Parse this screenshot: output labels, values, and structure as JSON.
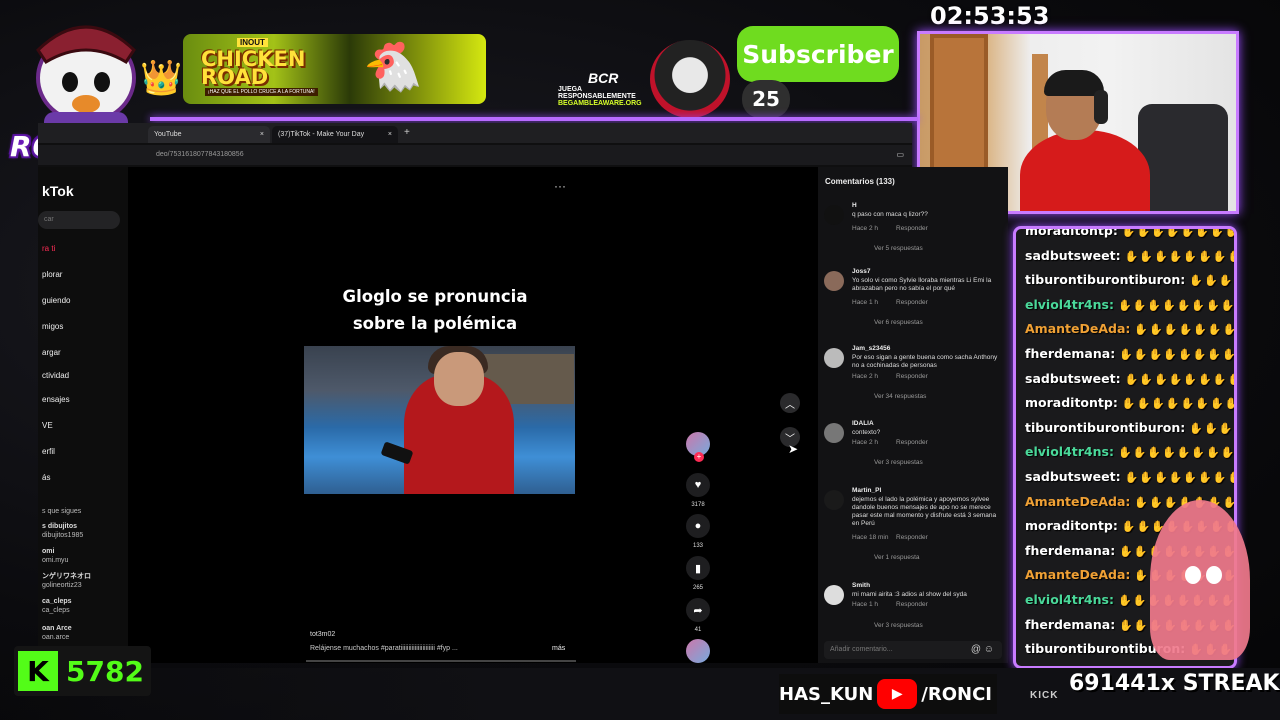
{
  "overlay": {
    "logo_text": "RONCHAS",
    "banner": {
      "brand": "INOUT",
      "title": "CHICKEN ROAD",
      "subtitle": "¡HAZ QUE EL POLLO CRUCE A LA FORTUNA!"
    },
    "responsible": {
      "brand": "BCR",
      "line1": "JUEGA RESPONSABLEMENTE",
      "line2": "BEGAMBLEAWARE.ORG"
    },
    "subscriber_label": "Subscriber",
    "subscriber_count": "25",
    "timer": "02:53:53",
    "kick_count": "5782",
    "social_text1": "HAS_KUN",
    "social_text2": "/RONCI",
    "sponsors": "KICK",
    "streak": "691441x STREAK",
    "accent": "#c87bff",
    "kick_green": "#53fc18"
  },
  "browser": {
    "tabs": [
      {
        "label": "YouTube",
        "close": "×"
      },
      {
        "label": "(37)TikTok - Make Your Day",
        "close": "×"
      }
    ],
    "new_tab": "+",
    "url": "deo/7531618077843180856"
  },
  "tiktok": {
    "logo": "kTok",
    "search_placeholder": "car",
    "nav": [
      "ra ti",
      "plorar",
      "guiendo",
      "migos",
      "argar",
      "ctividad",
      "ensajes",
      "VE",
      "erfil",
      "ás"
    ],
    "following_title": "s que sigues",
    "following": [
      {
        "name": "s dibujitos",
        "handle": "dibujitos1985"
      },
      {
        "name": "omi",
        "handle": "omi.myu"
      },
      {
        "name": "ンゲリワネオロ",
        "handle": "golineortiz23"
      },
      {
        "name": "ca_cleps",
        "handle": "ca_cleps"
      },
      {
        "name": "oan Arce",
        "handle": "oan.arce"
      }
    ],
    "more_icon": "···",
    "video_title_line1": "Gloglo se pronuncia",
    "video_title_line2": "sobre la polémica",
    "actions": {
      "likes": "3178",
      "comments": "133",
      "saves": "265",
      "shares": "41"
    },
    "author": "tot3m02",
    "caption": "Relájense muchachos  #paratiiiiiiiiiiiiiiiiiiiiii  #fyp  ...",
    "caption_more": "más",
    "comments_title": "Comentarios (133)",
    "comments": [
      {
        "user": "H",
        "text": "q paso con maca q lizor??",
        "time": "Hace 2 h",
        "reply": "Responder",
        "replies": "Ver 5 respuestas"
      },
      {
        "user": "Joss7",
        "text": "Yo solo vi como Sylvie lloraba mientras Li Emi la abrazaban pero no sabía el por qué",
        "time": "Hace 1 h",
        "reply": "Responder",
        "replies": "Ver 6 respuestas"
      },
      {
        "user": "Jam_s23456",
        "text": "Por eso sigan a gente buena como sacha Anthony no a cochinadas de personas",
        "time": "Hace 2 h",
        "reply": "Responder",
        "replies": "Ver 34 respuestas"
      },
      {
        "user": "IDALIA",
        "text": "contexto?",
        "time": "Hace 2 h",
        "reply": "Responder",
        "replies": "Ver 3 respuestas"
      },
      {
        "user": "Martin_Pl",
        "text": "dejemos el lado la polémica y apoyemos sylvee dandole buenos mensajes de apo no se merece pasar este mal momento y disfrute está 3 semana en Perú",
        "time": "Hace 18 min",
        "reply": "Responder",
        "replies": "Ver 1 respuesta"
      },
      {
        "user": "Smith",
        "text": "mi mami airita :3 adios al show del syda",
        "time": "Hace 1 h",
        "reply": "Responder",
        "replies": "Ver 3 respuestas"
      }
    ],
    "add_comment_placeholder": "Añadir comentario..."
  },
  "chat": [
    {
      "user": "moraditontp:",
      "color": "#ffffff"
    },
    {
      "user": "sadbutsweet:",
      "color": "#ffffff"
    },
    {
      "user": "tiburontiburontiburon:",
      "color": "#ffffff"
    },
    {
      "user": "elviol4tr4ns:",
      "color": "#4ad99a"
    },
    {
      "user": "AmanteDeAda:",
      "color": "#f0a135"
    },
    {
      "user": "fherdemana:",
      "color": "#ffffff"
    },
    {
      "user": "sadbutsweet:",
      "color": "#ffffff"
    },
    {
      "user": "moraditontp:",
      "color": "#ffffff"
    },
    {
      "user": "tiburontiburontiburon:",
      "color": "#ffffff"
    },
    {
      "user": "elviol4tr4ns:",
      "color": "#4ad99a"
    },
    {
      "user": "sadbutsweet:",
      "color": "#ffffff"
    },
    {
      "user": "AmanteDeAda:",
      "color": "#f0a135"
    },
    {
      "user": "moraditontp:",
      "color": "#ffffff"
    },
    {
      "user": "fherdemana:",
      "color": "#ffffff"
    },
    {
      "user": "AmanteDeAda:",
      "color": "#f0a135"
    },
    {
      "user": "elviol4tr4ns:",
      "color": "#4ad99a"
    },
    {
      "user": "fherdemana:",
      "color": "#ffffff"
    },
    {
      "user": "tiburontiburontiburon:",
      "color": "#ffffff"
    }
  ]
}
